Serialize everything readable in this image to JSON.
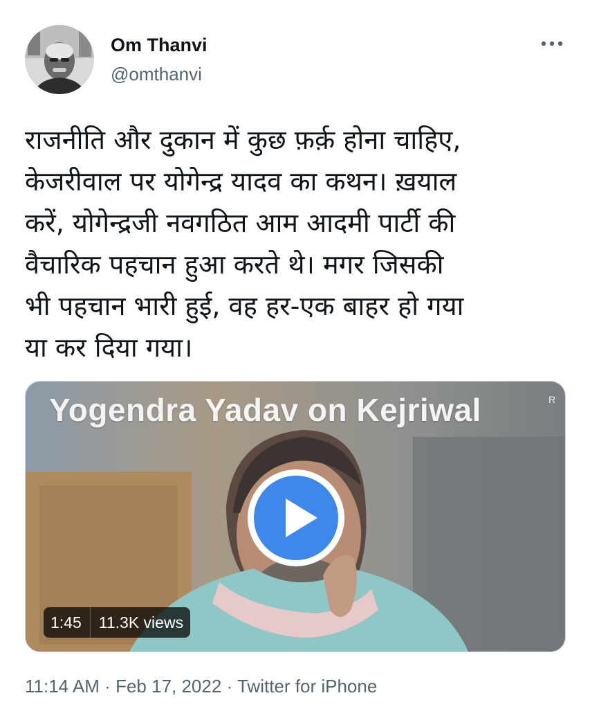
{
  "author": {
    "name": "Om Thanvi",
    "handle": "@omthanvi",
    "avatar_icon": "profile-photo"
  },
  "more_icon": "more-options-icon",
  "tweet": {
    "text": "राजनीति और दुकान में कुछ फ़र्क़ होना चाहिए,\nकेजरीवाल पर योगेन्द्र यादव का कथन। ख़याल\nकरें, योगेन्द्रजी नवगठित आम आदमी पार्टी की\nवैचारिक पहचान हुआ करते थे। मगर जिसकी\nभी पहचान भारी हुई, वह हर-एक बाहर हो गया\nया कर दिया गया।"
  },
  "media": {
    "title": "Yogendra Yadav on Kejriwal",
    "title_mark": "R",
    "duration": "1:45",
    "views": "11.3K views",
    "play_icon": "play-icon",
    "play_color": "#3d88e8"
  },
  "meta": {
    "time": "11:14 AM",
    "dot1": "·",
    "date": "Feb 17, 2022",
    "dot2": "·",
    "source": "Twitter for iPhone"
  },
  "colors": {
    "text": "#0f1419",
    "secondary": "#536471"
  }
}
